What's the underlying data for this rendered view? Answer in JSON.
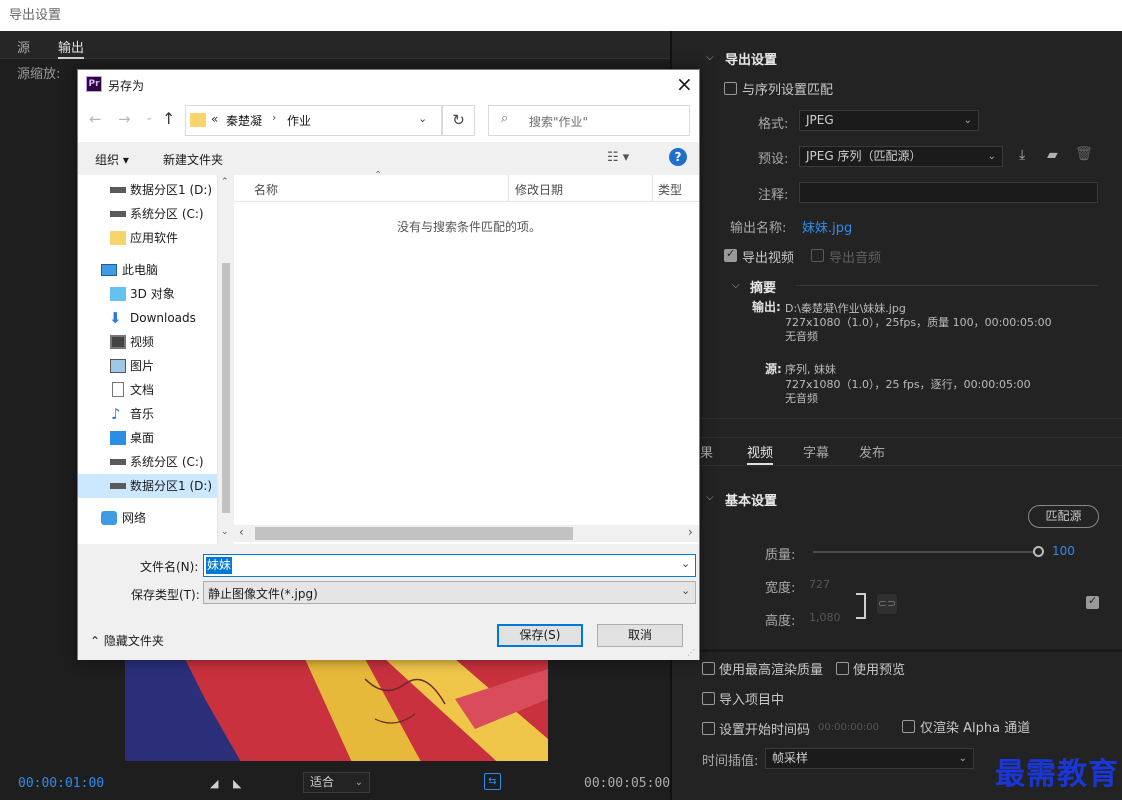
{
  "window": {
    "title": "导出设置"
  },
  "left": {
    "tabs": [
      "源",
      "输出"
    ],
    "source_scale_label": "源缩放:",
    "timecode_start": "00:00:01:00",
    "timecode_end": "00:00:05:00",
    "fit_select": "适合"
  },
  "right": {
    "export_settings": "导出设置",
    "match_sequence": "与序列设置匹配",
    "format_label": "格式:",
    "format_value": "JPEG",
    "preset_label": "预设:",
    "preset_value": "JPEG 序列（匹配源）",
    "comments_label": "注释:",
    "output_name_label": "输出名称:",
    "output_name_value": "妹妹.jpg",
    "export_video": "导出视频",
    "export_audio": "导出音频",
    "summary_title": "摘要",
    "output_label": "输出:",
    "output_path": "D:\\秦楚凝\\作业\\妹妹.jpg",
    "output_spec": "727x1080（1.0），25fps，质量 100，00:00:05:00",
    "output_audio": "无音频",
    "source_label": "源:",
    "source_name": "序列, 妹妹",
    "source_spec": "727x1080（1.0），25 fps，逐行，00:00:05:00",
    "source_audio": "无音频",
    "tabs": [
      "果",
      "视频",
      "字幕",
      "发布"
    ],
    "basic_settings": "基本设置",
    "match_source_btn": "匹配源",
    "quality_label": "质量:",
    "quality_value": "100",
    "width_label": "宽度:",
    "width_value": "727",
    "height_label": "高度:",
    "height_value": "1,080",
    "max_render_quality": "使用最高渲染质量",
    "use_previews": "使用预览",
    "import_into_project": "导入项目中",
    "set_start_timecode": "设置开始时间码",
    "start_timecode_value": "00:00:00:00",
    "render_alpha_only": "仅渲染 Alpha 通道",
    "time_interp_label": "时间插值:",
    "time_interp_value": "帧采样"
  },
  "dialog": {
    "title": "另存为",
    "app_icon": "Pr",
    "breadcrumb": [
      "«",
      "秦楚凝",
      "作业"
    ],
    "search_placeholder": "搜索\"作业\"",
    "organize": "组织",
    "new_folder": "新建文件夹",
    "tree": [
      "数据分区1 (D:)",
      "系统分区 (C:)",
      "应用软件",
      "此电脑",
      "3D 对象",
      "Downloads",
      "视频",
      "图片",
      "文档",
      "音乐",
      "桌面",
      "系统分区 (C:)",
      "数据分区1 (D:)",
      "网络"
    ],
    "columns": [
      "名称",
      "修改日期",
      "类型"
    ],
    "empty_message": "没有与搜索条件匹配的项。",
    "filename_label": "文件名(N):",
    "filename_value": "妹妹",
    "filetype_label": "保存类型(T):",
    "filetype_value": "静止图像文件(*.jpg)",
    "hide_folders": "隐藏文件夹",
    "save_btn": "保存(S)",
    "cancel_btn": "取消"
  },
  "watermark": "最需教育",
  "colors": {
    "accent_blue": "#2d8ceb",
    "dialog_blue": "#0078d7",
    "watermark": "#1a36d6"
  }
}
